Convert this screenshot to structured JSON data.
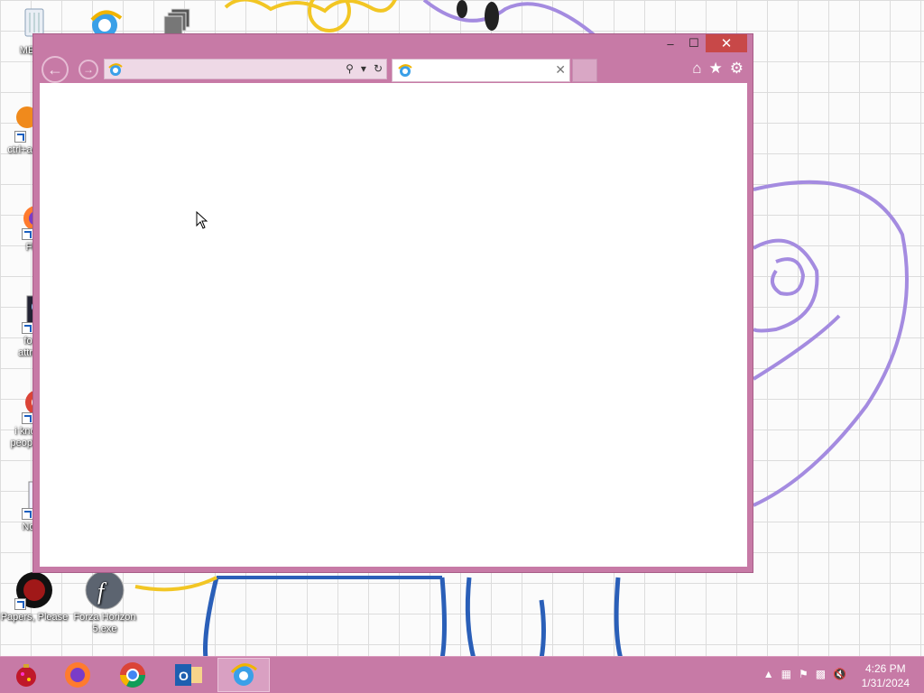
{
  "desktop": {
    "icons": [
      {
        "label": "MEMZ",
        "icon": "recycle-bin-icon"
      },
      {
        "label": "",
        "icon": "internet-explorer-icon"
      },
      {
        "label": "",
        "icon": "windows-stack-icon"
      },
      {
        "label": "ctrl+a",
        "icon": "ctrl-a-icon"
      },
      {
        "label": "Fire",
        "icon": "firefox-icon"
      },
      {
        "label": "fo attra",
        "icon": "settings-app-icon"
      },
      {
        "label": "i kno people",
        "icon": "chrome-icon"
      },
      {
        "label": "Note",
        "icon": "notepad-icon"
      },
      {
        "label": "Papers, Please",
        "icon": "papers-please-icon"
      },
      {
        "label": "Forza Horizon 5.exe",
        "icon": "flash-icon"
      }
    ]
  },
  "browser": {
    "address": {
      "value": "",
      "placeholder": ""
    },
    "tab": {
      "title": ""
    },
    "window_buttons": {
      "minimize": "–",
      "maximize": "☐",
      "close": "✕"
    }
  },
  "taskbar": {
    "apps": [
      "start-ornament",
      "firefox",
      "chrome",
      "outlook",
      "internet-explorer"
    ],
    "active_app": "internet-explorer",
    "clock": {
      "time": "4:26 PM",
      "date": "1/31/2024"
    }
  },
  "colors": {
    "window_accent": "#c77aa6",
    "taskbar": "#c77aa6",
    "close_button": "#c84848"
  }
}
